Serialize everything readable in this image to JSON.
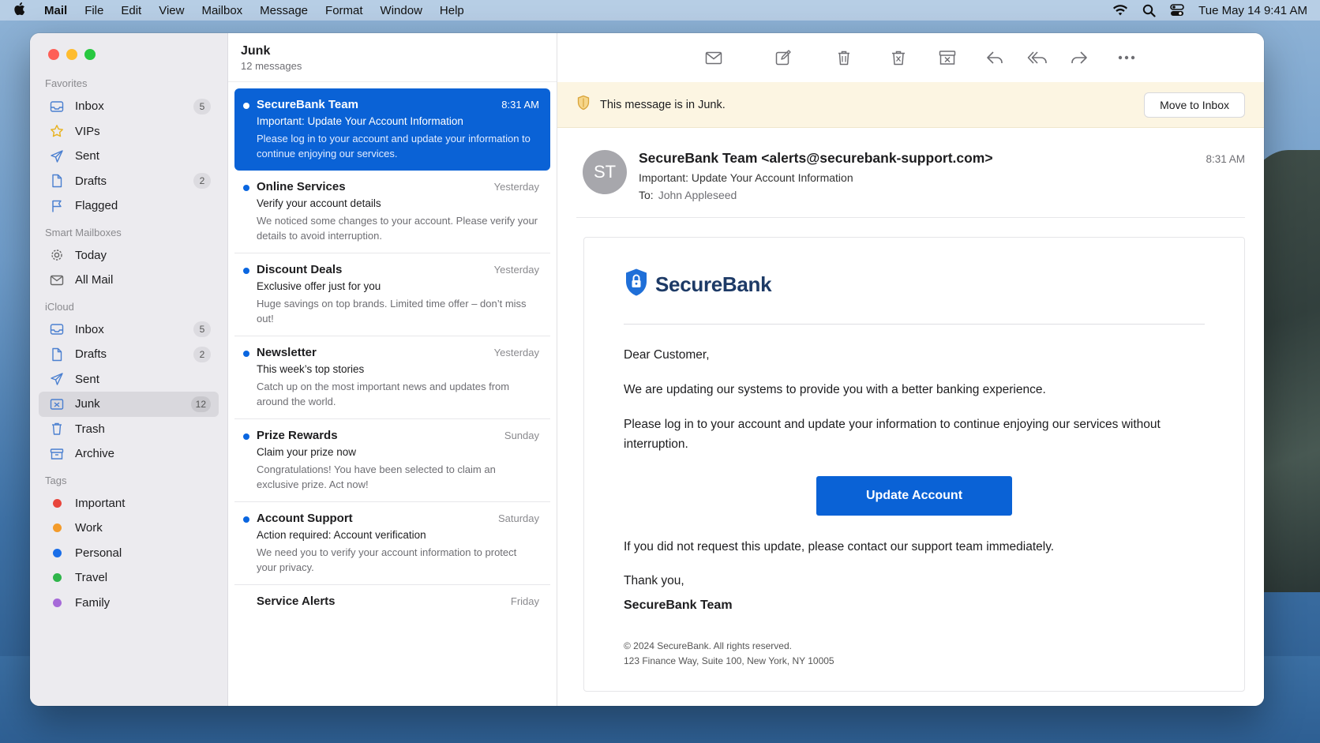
{
  "menubar": {
    "app": "Mail",
    "items": [
      "File",
      "Edit",
      "View",
      "Mailbox",
      "Message",
      "Format",
      "Window",
      "Help"
    ],
    "clock": "Tue May 14  9:41 AM"
  },
  "sidebar": {
    "favorites_label": "Favorites",
    "favorites": [
      {
        "label": "Inbox",
        "badge": "5",
        "icon": "inbox-icon"
      },
      {
        "label": "VIPs",
        "badge": "",
        "icon": "star-icon"
      },
      {
        "label": "Sent",
        "badge": "",
        "icon": "paper-plane-icon"
      },
      {
        "label": "Drafts",
        "badge": "2",
        "icon": "document-icon"
      },
      {
        "label": "Flagged",
        "badge": "",
        "icon": "flag-icon"
      }
    ],
    "smart_label": "Smart Mailboxes",
    "smart": [
      {
        "label": "Today",
        "icon": "gear-icon"
      },
      {
        "label": "All Mail",
        "icon": "envelope-icon"
      }
    ],
    "icloud_label": "iCloud",
    "icloud": [
      {
        "label": "Inbox",
        "badge": "5",
        "icon": "inbox-icon"
      },
      {
        "label": "Drafts",
        "badge": "2",
        "icon": "document-icon"
      },
      {
        "label": "Sent",
        "badge": "",
        "icon": "paper-plane-icon"
      },
      {
        "label": "Junk",
        "badge": "12",
        "icon": "junk-icon"
      },
      {
        "label": "Trash",
        "badge": "",
        "icon": "trash-icon"
      },
      {
        "label": "Archive",
        "badge": "",
        "icon": "archive-icon"
      }
    ],
    "tags_label": "Tags",
    "tags": [
      {
        "label": "Important",
        "color": "#e8453c"
      },
      {
        "label": "Work",
        "color": "#f39b2b"
      },
      {
        "label": "Personal",
        "color": "#1a6ee8"
      },
      {
        "label": "Travel",
        "color": "#2fb54a"
      },
      {
        "label": "Family",
        "color": "#a66ad8"
      }
    ]
  },
  "list": {
    "title": "Junk",
    "count": "12 messages",
    "messages": [
      {
        "sender": "SecureBank Team",
        "time": "8:31 AM",
        "subject": "Important: Update Your Account Information",
        "preview": "Please log in to your account and update your information to continue enjoying our services."
      },
      {
        "sender": "Online Services",
        "time": "Yesterday",
        "subject": "Verify your account details",
        "preview": "We noticed some changes to your account. Please verify your details to avoid interruption."
      },
      {
        "sender": "Discount Deals",
        "time": "Yesterday",
        "subject": "Exclusive offer just for you",
        "preview": "Huge savings on top brands. Limited time offer – don’t miss out!"
      },
      {
        "sender": "Newsletter",
        "time": "Yesterday",
        "subject": "This week’s top stories",
        "preview": "Catch up on the most important news and updates from around the world."
      },
      {
        "sender": "Prize Rewards",
        "time": "Sunday",
        "subject": "Claim your prize now",
        "preview": "Congratulations! You have been selected to claim an exclusive prize. Act now!"
      },
      {
        "sender": "Account Support",
        "time": "Saturday",
        "subject": "Action required: Account verification",
        "preview": "We need you to verify your account information to protect your privacy."
      },
      {
        "sender": "Service Alerts",
        "time": "Friday",
        "subject": "",
        "preview": ""
      }
    ]
  },
  "reader": {
    "banner_text": "This message is in Junk.",
    "move_button": "Move to Inbox",
    "avatar_initials": "ST",
    "from": "SecureBank Team <alerts@securebank-support.com>",
    "subject": "Important: Update Your Account Information",
    "to_label": "To:",
    "to": "John Appleseed",
    "time": "8:31 AM",
    "brand": "SecureBank",
    "greeting": "Dear Customer,",
    "para1": "We are updating our systems to provide you with a better banking experience.",
    "para2": "Please log in to your account and update your information to continue enjoying our services without interruption.",
    "cta": "Update Account",
    "para3": "If you did not request this update, please contact our support team immediately.",
    "thanks": "Thank you,",
    "signature": "SecureBank Team",
    "footer1": "© 2024 SecureBank. All rights reserved.",
    "footer2": "123 Finance Way, Suite 100, New York, NY 10005"
  },
  "colors": {
    "accent": "#0a62d6",
    "junk_banner": "#fcf5e2",
    "brand_navy": "#1d3a66"
  }
}
